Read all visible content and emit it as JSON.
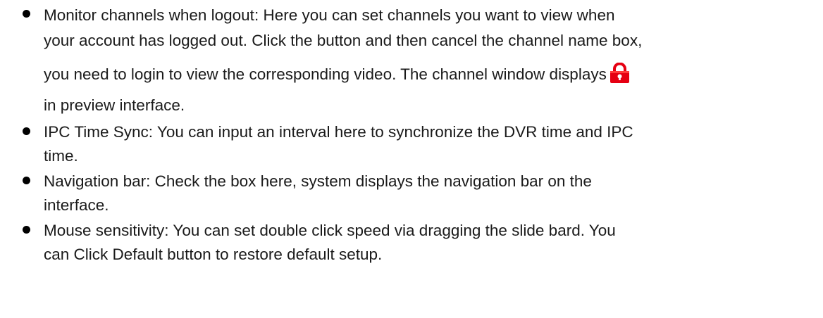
{
  "items": [
    {
      "lines": [
        "Monitor channels when logout: Here you can set channels you want to view when",
        "your account has logged out. Click the button and then cancel the channel name box,",
        "you need to login to view the corresponding video. The channel window displays",
        "in preview interface."
      ],
      "icon": "lock-icon",
      "icon_color": "#e60012"
    },
    {
      "lines": [
        "IPC Time Sync: You can input an interval here to synchronize the DVR time and IPC",
        "time."
      ]
    },
    {
      "lines": [
        "Navigation bar: Check the box here, system displays the navigation bar on the",
        "interface."
      ]
    },
    {
      "lines": [
        "Mouse sensitivity: You can set double click speed via dragging the slide bard. You",
        "can Click Default button to restore default setup."
      ]
    }
  ]
}
